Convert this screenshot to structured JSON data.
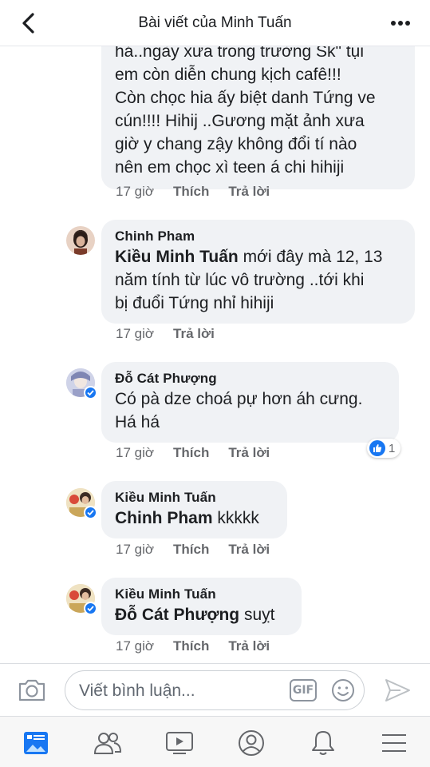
{
  "header": {
    "title": "Bài viết của Minh Tuấn"
  },
  "comments": [
    {
      "text": "hả..ngày xưa trong trường Sk\" tụi em còn diễn chung kịch cafê!!! Còn chọc hia ấy biệt danh Tứng ve cún!!!! Hihij ..Gương mặt ảnh xưa giờ y chang zậy không đổi tí nào nên em chọc xì teen á chi hihiji",
      "lines": [
        "hả..ngày xưa trong trường Sk\" tụi",
        "em còn diễn chung kịch cafê!!!",
        "Còn chọc hia ấy biệt danh Tứng ve",
        "cún!!!! Hihij ..Gương mặt ảnh xưa",
        "giờ y chang zậy không đổi tí nào",
        "nên em chọc xì teen á chi hihiji"
      ],
      "time": "17 giờ",
      "like": "Thích",
      "reply": "Trả lời"
    },
    {
      "author": "Chinh Pham",
      "tag": "Kiều Minh Tuấn",
      "lines": [
        " mới đây mà 12, 13",
        "năm tính từ lúc vô trường ..tới khi",
        "bị đuổi Tứng nhỉ hihiji"
      ],
      "time": "17 giờ",
      "reply": "Trả lời"
    },
    {
      "author": "Đỗ Cát Phượng",
      "lines": [
        "Có pà dze choá pự hơn áh cưng.",
        "Há há"
      ],
      "time": "17 giờ",
      "like": "Thích",
      "reply": "Trả lời",
      "reaction_count": "1"
    },
    {
      "author": "Kiều Minh Tuấn",
      "tag": "Chinh Pham",
      "text": " kkkkk",
      "time": "17 giờ",
      "like": "Thích",
      "reply": "Trả lời"
    },
    {
      "author": "Kiều Minh Tuấn",
      "tag": "Đỗ Cát Phượng",
      "text": " suỵt",
      "time": "17 giờ",
      "like": "Thích",
      "reply": "Trả lời"
    }
  ],
  "composer": {
    "placeholder": "Viết bình luận...",
    "gif_label": "GIF"
  },
  "icons": {
    "back": "chevron-left-icon",
    "more": "more-dots-icon",
    "camera": "camera-icon",
    "emoji": "smiley-icon",
    "send": "send-icon",
    "tabs": [
      "news-feed-icon",
      "friends-icon",
      "watch-icon",
      "profile-icon",
      "notifications-icon",
      "menu-icon"
    ]
  },
  "colors": {
    "accent": "#1877f2",
    "bubble": "#f0f2f5",
    "meta": "#65676b"
  }
}
